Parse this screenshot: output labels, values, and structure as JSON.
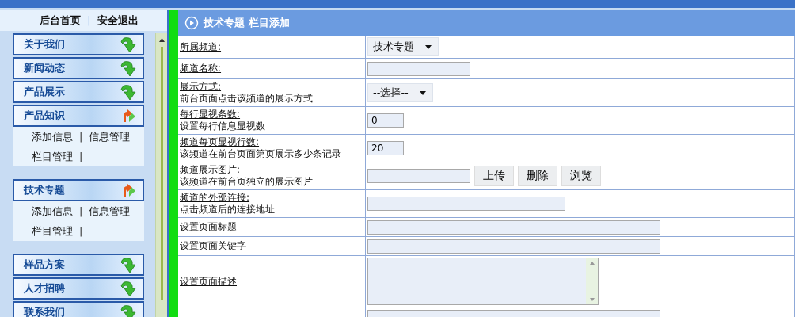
{
  "sidebar": {
    "top_links": [
      {
        "kind": "link",
        "text": "后台首页"
      },
      {
        "kind": "sep",
        "text": "|"
      },
      {
        "kind": "link",
        "text": "安全退出"
      }
    ],
    "groups": [
      {
        "items": [
          {
            "label": "关于我们",
            "expanded": false
          },
          {
            "label": "新闻动态",
            "expanded": false
          },
          {
            "label": "产品展示",
            "expanded": false
          },
          {
            "label": "产品知识",
            "expanded": true,
            "rows": [
              [
                {
                  "kind": "link",
                  "text": "添加信息"
                },
                {
                  "kind": "sep",
                  "text": "|"
                },
                {
                  "kind": "link",
                  "text": "信息管理"
                }
              ],
              [
                {
                  "kind": "link",
                  "text": "栏目管理"
                },
                {
                  "kind": "sep",
                  "text": "|"
                }
              ]
            ]
          }
        ]
      },
      {
        "items": [
          {
            "label": "技术专题",
            "expanded": true,
            "rows": [
              [
                {
                  "kind": "link",
                  "text": "添加信息"
                },
                {
                  "kind": "sep",
                  "text": "|"
                },
                {
                  "kind": "link",
                  "text": "信息管理"
                }
              ],
              [
                {
                  "kind": "link",
                  "text": "栏目管理"
                },
                {
                  "kind": "sep",
                  "text": "|"
                }
              ]
            ]
          }
        ]
      },
      {
        "items": [
          {
            "label": "样品方案",
            "expanded": false
          },
          {
            "label": "人才招聘",
            "expanded": false
          },
          {
            "label": "联系我们",
            "expanded": false
          }
        ]
      }
    ]
  },
  "panel": {
    "title": "技术专题 栏目添加"
  },
  "form": [
    {
      "label": "所属频道:",
      "kind": "select",
      "value": "技术专题"
    },
    {
      "label": "频道名称:",
      "kind": "text"
    },
    {
      "label": "展示方式:",
      "hint": "前台页面点击该频道的展示方式",
      "kind": "select",
      "value": "--选择--"
    },
    {
      "label": "每行显视条数:",
      "hint": "设置每行信息显视数",
      "kind": "tiny",
      "value": "0"
    },
    {
      "label": "频道每页显视行数:",
      "hint": "该频道在前台页面第页展示多少条记录",
      "kind": "tiny",
      "value": "20"
    },
    {
      "label": "频道展示图片:",
      "hint": "该频道在前台页独立的展示图片",
      "kind": "upload",
      "buttons": [
        "上传",
        "删除",
        "浏览"
      ]
    },
    {
      "label": "频道的外部连接:",
      "hint": "点击频道后的连接地址",
      "kind": "medium"
    },
    {
      "label": "设置页面标题",
      "kind": "wide"
    },
    {
      "label": "设置页面关键字",
      "kind": "wide"
    },
    {
      "label": "设置页面描述",
      "kind": "textarea"
    },
    {
      "kind": "wide"
    }
  ]
}
